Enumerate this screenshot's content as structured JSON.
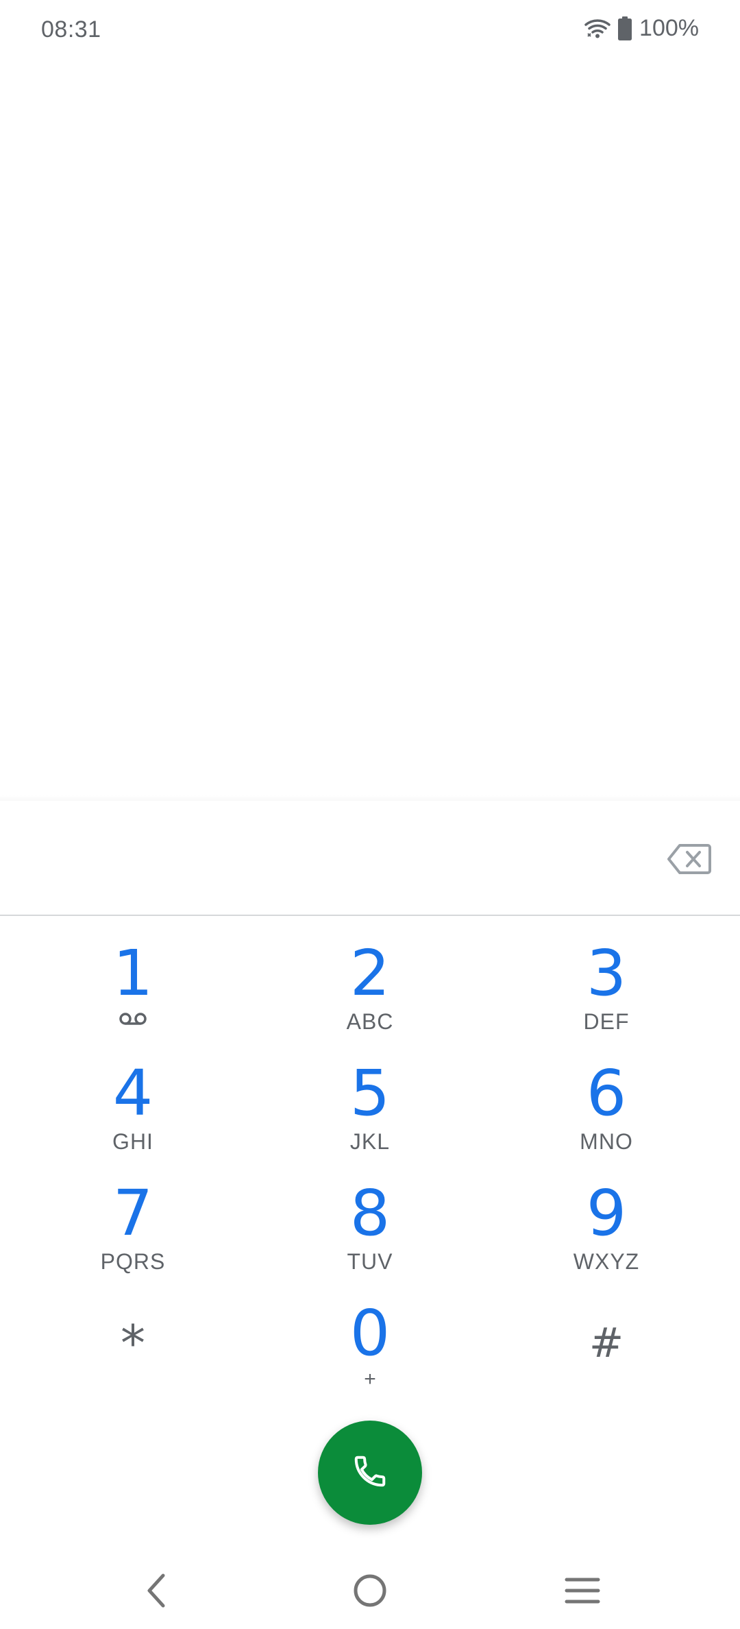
{
  "status_bar": {
    "time": "08:31",
    "battery_percent": "100%",
    "icons": [
      "wifi-icon",
      "battery-icon"
    ]
  },
  "dialer": {
    "number_value": "",
    "number_placeholder": "",
    "keys": [
      {
        "digit": "1",
        "sub": "",
        "sub_icon": "voicemail-icon"
      },
      {
        "digit": "2",
        "sub": "ABC"
      },
      {
        "digit": "3",
        "sub": "DEF"
      },
      {
        "digit": "4",
        "sub": "GHI"
      },
      {
        "digit": "5",
        "sub": "JKL"
      },
      {
        "digit": "6",
        "sub": "MNO"
      },
      {
        "digit": "7",
        "sub": "PQRS"
      },
      {
        "digit": "8",
        "sub": "TUV"
      },
      {
        "digit": "9",
        "sub": "WXYZ"
      },
      {
        "digit": "*",
        "sub": ""
      },
      {
        "digit": "0",
        "sub": "+"
      },
      {
        "digit": "#",
        "sub": ""
      }
    ],
    "call_icon": "phone-icon",
    "backspace_icon": "backspace-icon"
  },
  "nav_bar": {
    "icons": [
      "back-icon",
      "home-icon",
      "recents-icon"
    ]
  },
  "colors": {
    "digit": "#1a73e8",
    "secondary_text": "#5f6368",
    "call_button": "#0b8c3a",
    "divider": "#d5d7da"
  }
}
